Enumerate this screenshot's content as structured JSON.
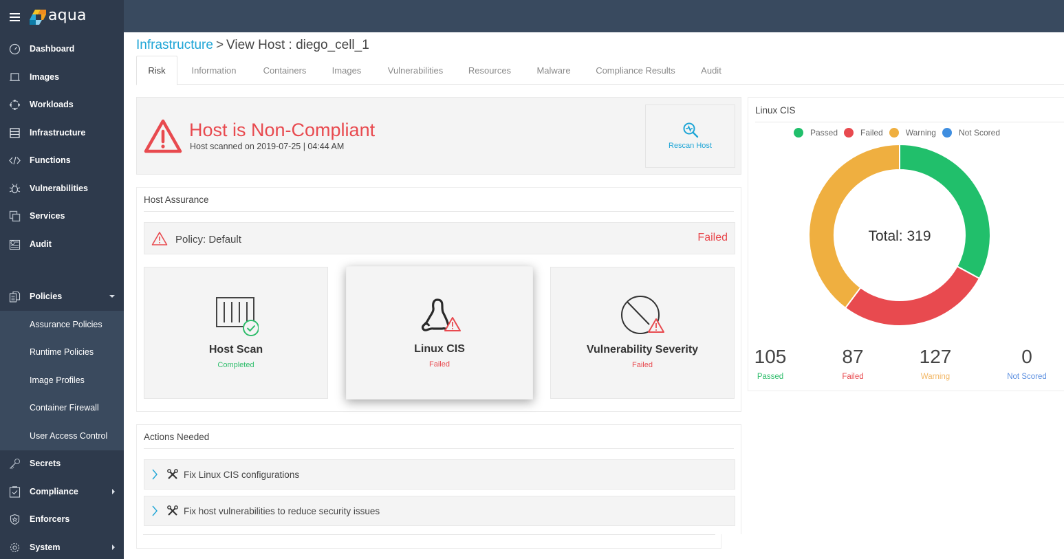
{
  "app": {
    "brand": "aqua",
    "menu_icon": "hamburger-icon"
  },
  "sidebar": {
    "items": [
      {
        "label": "Dashboard",
        "icon": "dashboard-gauge-icon"
      },
      {
        "label": "Images",
        "icon": "images-icon"
      },
      {
        "label": "Workloads",
        "icon": "workloads-icon"
      },
      {
        "label": "Infrastructure",
        "icon": "infrastructure-server-icon"
      },
      {
        "label": "Functions",
        "icon": "code-icon"
      },
      {
        "label": "Vulnerabilities",
        "icon": "bug-icon"
      },
      {
        "label": "Services",
        "icon": "services-icon"
      },
      {
        "label": "Audit",
        "icon": "audit-icon"
      },
      {
        "label": "Policies",
        "icon": "policies-icon",
        "expanded": true
      },
      {
        "label": "Secrets",
        "icon": "key-icon"
      },
      {
        "label": "Compliance",
        "icon": "compliance-icon",
        "has_submenu": true
      },
      {
        "label": "Enforcers",
        "icon": "shield-icon"
      },
      {
        "label": "System",
        "icon": "gear-icon",
        "has_submenu": true
      }
    ],
    "policies_submenu": [
      {
        "label": "Assurance Policies"
      },
      {
        "label": "Runtime Policies"
      },
      {
        "label": "Image Profiles"
      },
      {
        "label": "Container Firewall"
      },
      {
        "label": "User Access Control"
      }
    ]
  },
  "breadcrumb": {
    "parent": "Infrastructure",
    "separator": ">",
    "current": "View Host : diego_cell_1"
  },
  "tabs": [
    {
      "label": "Risk",
      "active": true
    },
    {
      "label": "Information"
    },
    {
      "label": "Containers"
    },
    {
      "label": "Images"
    },
    {
      "label": "Vulnerabilities"
    },
    {
      "label": "Resources"
    },
    {
      "label": "Malware"
    },
    {
      "label": "Compliance Results"
    },
    {
      "label": "Audit"
    }
  ],
  "status": {
    "title": "Host is Non-Compliant",
    "scanned_text": "Host scanned on 2019-07-25 | 04:44 AM",
    "rescan_label": "Rescan Host"
  },
  "host_assurance": {
    "title": "Host Assurance",
    "policy_label": "Policy: Default",
    "policy_status": "Failed",
    "cards": [
      {
        "title": "Host Scan",
        "status": "Completed",
        "status_color": "#2ebd6b"
      },
      {
        "title": "Linux CIS",
        "status": "Failed",
        "status_color": "#e84a4f"
      },
      {
        "title": "Vulnerability Severity",
        "status": "Failed",
        "status_color": "#e84a4f"
      }
    ]
  },
  "actions_needed": {
    "title": "Actions Needed",
    "items": [
      {
        "label": "Fix Linux CIS configurations"
      },
      {
        "label": "Fix host vulnerabilities to reduce security issues"
      }
    ]
  },
  "colors": {
    "sidebar_bg": "#2e3a4c",
    "topbar_bg": "#394a5f",
    "accent": "#1ea5d6",
    "danger": "#e84a4f",
    "passed": "#21bf6b",
    "failed": "#e84a4f",
    "warning": "#efaf40",
    "not_scored": "#3f8ee0"
  },
  "chart_data": {
    "type": "pie",
    "title": "Linux CIS",
    "center_label": "Total: 319",
    "total": 319,
    "legend_position": "top",
    "categories": [
      "Passed",
      "Failed",
      "Warning",
      "Not Scored"
    ],
    "values": [
      105,
      87,
      127,
      0
    ],
    "colors": [
      "#21bf6b",
      "#e84a4f",
      "#efaf40",
      "#3f8ee0"
    ],
    "label_colors": [
      "#2ebd6b",
      "#e84a4f",
      "#f2b766",
      "#5b8fe0"
    ],
    "stat_numbers": [
      "105",
      "87",
      "127",
      "0"
    ]
  }
}
